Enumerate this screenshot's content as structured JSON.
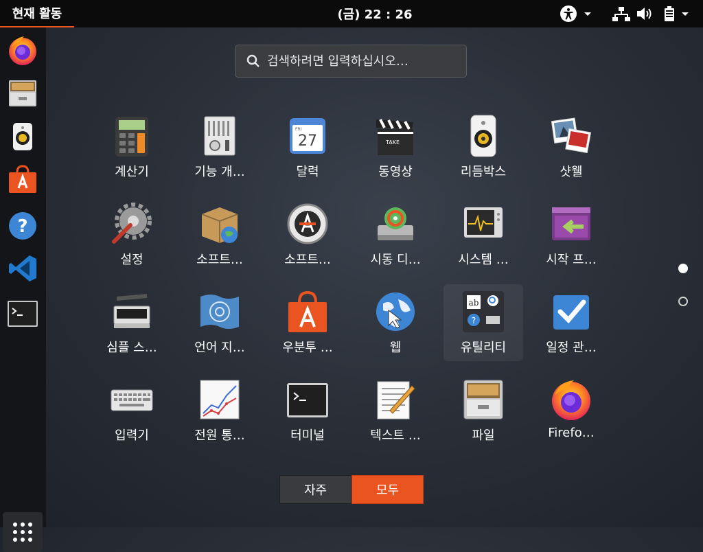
{
  "topbar": {
    "activities": "현재 활동",
    "clock": "(금) 22 : 26",
    "icons": [
      "accessibility-icon",
      "network-icon",
      "volume-icon",
      "battery-icon"
    ]
  },
  "dock": {
    "items": [
      "firefox-icon",
      "file-cabinet-icon",
      "rhythmbox-icon",
      "ubuntu-software-icon",
      "help-icon",
      "vscode-icon",
      "terminal-icon"
    ],
    "show_apps": "app-grid-icon"
  },
  "search": {
    "placeholder": "검색하려면 입력하십시오…"
  },
  "apps": [
    {
      "label": "계산기",
      "icon": "calculator-icon"
    },
    {
      "label": "기능 개…",
      "icon": "control-panel-icon"
    },
    {
      "label": "달력",
      "icon": "calendar-icon",
      "day": "27",
      "day_abbr": "FRI"
    },
    {
      "label": "동영상",
      "icon": "clapperboard-icon",
      "clapper_text": "TAKE"
    },
    {
      "label": "리듬박스",
      "icon": "speaker-icon"
    },
    {
      "label": "샷웰",
      "icon": "photos-icon"
    },
    {
      "label": "설정",
      "icon": "settings-gear-icon"
    },
    {
      "label": "소프트…",
      "icon": "software-box-icon"
    },
    {
      "label": "소프트…",
      "icon": "software-update-icon"
    },
    {
      "label": "시동 디…",
      "icon": "startup-disk-icon"
    },
    {
      "label": "시스템 …",
      "icon": "system-monitor-icon"
    },
    {
      "label": "시작 프…",
      "icon": "startup-apps-icon"
    },
    {
      "label": "심플 스…",
      "icon": "scanner-icon"
    },
    {
      "label": "언어 지…",
      "icon": "language-flag-icon"
    },
    {
      "label": "우분투 …",
      "icon": "ubuntu-bag-icon"
    },
    {
      "label": "웹",
      "icon": "web-globe-icon"
    },
    {
      "label": "유틸리티",
      "icon": "utilities-folder-icon"
    },
    {
      "label": "일정 관…",
      "icon": "checkbox-icon"
    },
    {
      "label": "입력기",
      "icon": "keyboard-icon"
    },
    {
      "label": "전원 통…",
      "icon": "power-chart-icon"
    },
    {
      "label": "터미널",
      "icon": "terminal-icon"
    },
    {
      "label": "텍스트 …",
      "icon": "text-editor-icon"
    },
    {
      "label": "파일",
      "icon": "file-cabinet-icon"
    },
    {
      "label": "Firefo…",
      "icon": "firefox-icon"
    }
  ],
  "pagination": {
    "current": 1,
    "total": 2
  },
  "view_toggle": {
    "frequent": "자주",
    "all": "모두",
    "active": "all"
  },
  "colors": {
    "accent": "#e95420",
    "topbar": "#0b0b0c",
    "dock": "#141518"
  }
}
